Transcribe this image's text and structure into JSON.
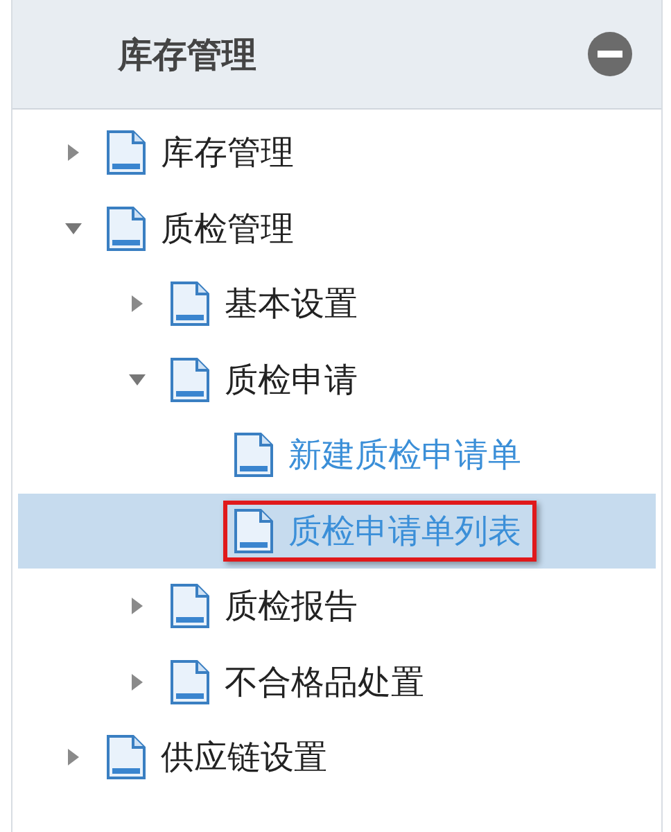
{
  "panel": {
    "title": "库存管理",
    "collapsed": false
  },
  "tree": [
    {
      "kind": "folder",
      "label": "库存管理",
      "expanded": false
    },
    {
      "kind": "folder",
      "label": "质检管理",
      "expanded": true,
      "children": [
        {
          "kind": "folder",
          "label": "基本设置",
          "expanded": false
        },
        {
          "kind": "folder",
          "label": "质检申请",
          "expanded": true,
          "children": [
            {
              "kind": "leaf",
              "label": "新建质检申请单",
              "selected": false,
              "highlighted": false
            },
            {
              "kind": "leaf",
              "label": "质检申请单列表",
              "selected": true,
              "highlighted": true
            }
          ]
        },
        {
          "kind": "folder",
          "label": "质检报告",
          "expanded": false
        },
        {
          "kind": "folder",
          "label": "不合格品处置",
          "expanded": false
        }
      ]
    },
    {
      "kind": "folder",
      "label": "供应链设置",
      "expanded": false
    }
  ]
}
